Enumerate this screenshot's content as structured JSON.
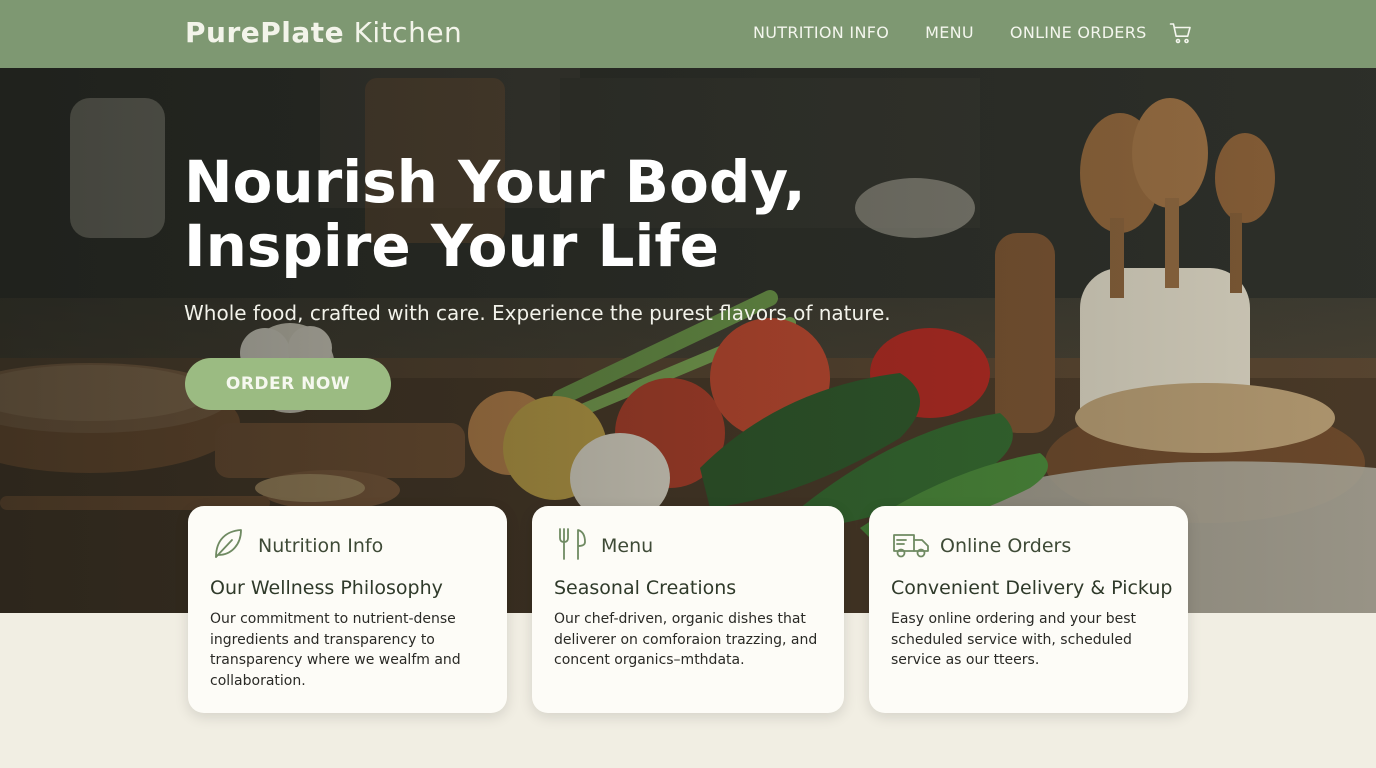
{
  "header": {
    "brand_bold": "PurePlate",
    "brand_light": "Kitchen",
    "nav": [
      "NUTRITION INFO",
      "MENU",
      "ONLINE ORDERS"
    ],
    "cart_icon": "cart-icon"
  },
  "hero": {
    "headline_line1": "Nourish Your Body,",
    "headline_line2": "Inspire Your Life",
    "subline": "Whole food, crafted with care. Experience the purest flavors of nature.",
    "cta": "ORDER NOW"
  },
  "cards": [
    {
      "icon": "leaf-icon",
      "title": "Nutrition Info",
      "subtitle": "Our Wellness Philosophy",
      "body": "Our commitment to nutrient-dense ingredients and transparency to transparency where we wealfm and collaboration."
    },
    {
      "icon": "fork-knife-icon",
      "title": "Menu",
      "subtitle": "Seasonal Creations",
      "body": "Our chef-driven, organic dishes that deliverer on comforaion trazzing, and concent organics–mthdata."
    },
    {
      "icon": "delivery-truck-icon",
      "title": "Online Orders",
      "subtitle": "Convenient Delivery & Pickup",
      "body": "Easy online ordering and your best scheduled service with, scheduled service as our tteers."
    }
  ],
  "colors": {
    "header_bg": "#7e9872",
    "cta_bg": "#9bbb82",
    "page_bg": "#f1eee3",
    "card_bg": "#fdfcf7",
    "icon_stroke": "#6f8a62"
  }
}
